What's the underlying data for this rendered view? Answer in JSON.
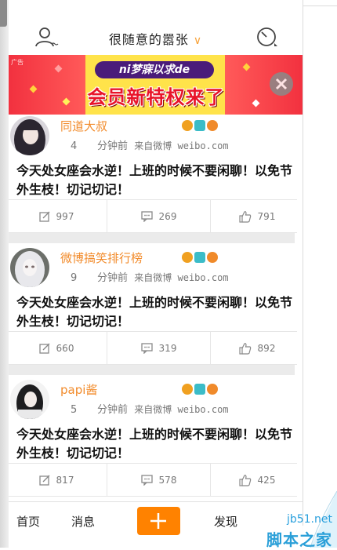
{
  "header": {
    "title": "很随意的嚣张",
    "caret": "∨"
  },
  "banner": {
    "ad_tag": "广告",
    "slogan_top": "ni梦寐以求de",
    "slogan_main": "会员新特权来了"
  },
  "posts": [
    {
      "name": "同道大叔",
      "time_num": "4",
      "time_unit": "分钟前",
      "source": "来自微博 weibo.com",
      "text": "今天处女座会水逆！上班的时候不要闲聊！以免节外生枝！切记切记！",
      "reposts": "997",
      "comments": "269",
      "likes": "791"
    },
    {
      "name": "微博搞笑排行榜",
      "time_num": "9",
      "time_unit": "分钟前",
      "source": "来自微博 weibo.com",
      "text": "今天处女座会水逆！上班的时候不要闲聊！以免节外生枝！切记切记！",
      "reposts": "660",
      "comments": "319",
      "likes": "892"
    },
    {
      "name": "papi酱",
      "time_num": "5",
      "time_unit": "分钟前",
      "source": "来自微博 weibo.com",
      "text": "今天处女座会水逆！上班的时候不要闲聊！以免节外生枝！切记切记！",
      "reposts": "817",
      "comments": "578",
      "likes": "425"
    }
  ],
  "tabbar": {
    "home": "首页",
    "messages": "消息",
    "discover": "发现"
  },
  "watermark": {
    "site": "jb51.net",
    "brand": "脚本之家"
  },
  "colors": {
    "accent": "#ff8200",
    "username": "#f28b2b",
    "link": "#2aa0dd"
  }
}
